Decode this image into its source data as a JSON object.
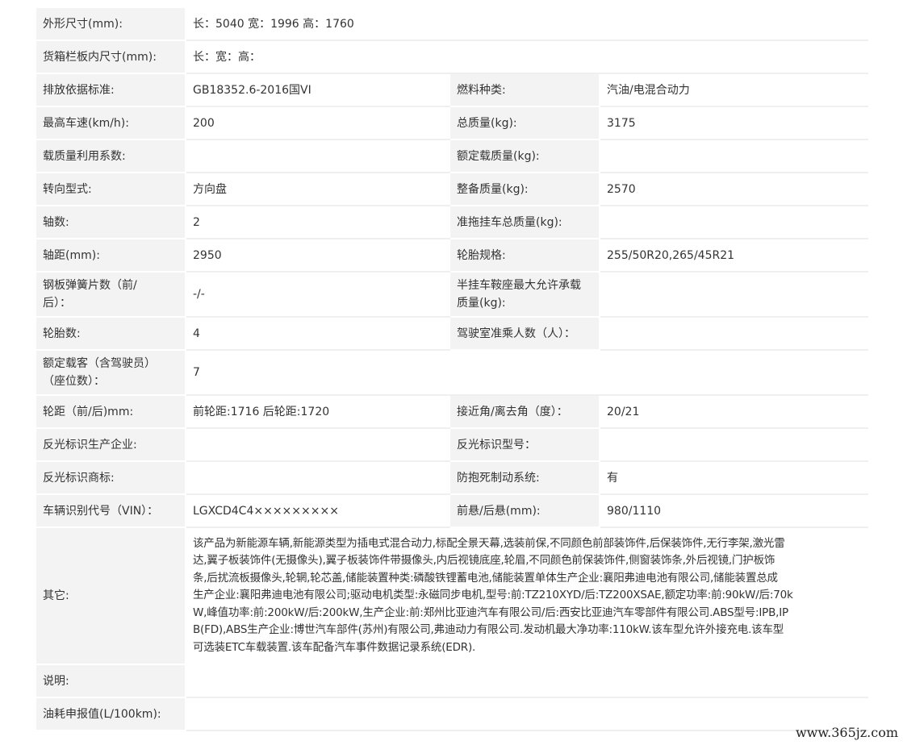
{
  "rows": [
    {
      "label": "外形尺寸(mm):",
      "value": "长：5040 宽：1996 高：1760"
    },
    {
      "label": "货箱栏板内尺寸(mm):",
      "value": "长：宽：高："
    },
    {
      "label": "排放依据标准:",
      "value": "GB18352.6-2016国VI",
      "label2": "燃料种类:",
      "value2": "汽油/电混合动力"
    },
    {
      "label": "最高车速(km/h):",
      "value": "200",
      "label2": "总质量(kg):",
      "value2": "3175"
    },
    {
      "label": "载质量利用系数:",
      "value": "",
      "label2": "额定载质量(kg):",
      "value2": ""
    },
    {
      "label": "转向型式:",
      "value": "方向盘",
      "label2": "整备质量(kg):",
      "value2": "2570"
    },
    {
      "label": "轴数:",
      "value": "2",
      "label2": "准拖挂车总质量(kg):",
      "value2": ""
    },
    {
      "label": "轴距(mm):",
      "value": "2950",
      "label2": "轮胎规格:",
      "value2": "255/50R20,265/45R21"
    },
    {
      "label_lines": [
        "钢板弹簧片数（前/",
        "后）："
      ],
      "value": "-/-",
      "label2_lines": [
        "半挂车鞍座最大允许承载",
        "质量(kg):"
      ],
      "value2": ""
    },
    {
      "label": "轮胎数:",
      "value": "4",
      "label2": "驾驶室准乘人数（人）：",
      "value2": ""
    },
    {
      "label_lines": [
        "额定载客（含驾驶员）",
        "（座位数）："
      ],
      "value": "7"
    },
    {
      "label": "轮距（前/后)mm:",
      "value": "前轮距:1716 后轮距:1720",
      "label2": "接近角/离去角（度）：",
      "value2": "20/21"
    },
    {
      "label": "反光标识生产企业:",
      "value": "",
      "label2": "反光标识型号：",
      "value2": ""
    },
    {
      "label": "反光标识商标:",
      "value": "",
      "label2": "防抱死制动系统:",
      "value2": "有"
    },
    {
      "label": "车辆识别代号（VIN）：",
      "value": "LGXCD4C4×××××××××",
      "label2": "前悬/后悬(mm):",
      "value2": "980/1110"
    }
  ],
  "other": {
    "label": "其它:",
    "lines": [
      "该产品为新能源车辆,新能源类型为插电式混合动力,标配全景天幕,选装前保,不同颜色前部装饰件,后保装饰件,无行李架,激光雷",
      "达,翼子板装饰件(无摄像头),翼子板装饰件带摄像头,内后视镜底座,轮眉,不同颜色前保装饰件,侧窗装饰条,外后视镜,门护板饰",
      "条,后扰流板摄像头,轮辋,轮芯盖,储能装置种类:磷酸铁锂蓄电池,储能装置单体生产企业:襄阳弗迪电池有限公司,储能装置总成",
      "生产企业:襄阳弗迪电池有限公司;驱动电机类型:永磁同步电机,型号:前:TZ210XYD/后:TZ200XSAE,额定功率:前:90kW/后:70k",
      "W,峰值功率:前:200kW/后:200kW,生产企业:前:郑州比亚迪汽车有限公司/后:西安比亚迪汽车零部件有限公司.ABS型号:IPB,IP",
      "B(FD),ABS生产企业:博世汽车部件(苏州)有限公司,弗迪动力有限公司.发动机最大净功率:110kW.该车型允许外接充电.该车型",
      "可选装ETC车载装置.该车配备汽车事件数据记录系统(EDR)."
    ]
  },
  "note": {
    "label": "说明:",
    "value": ""
  },
  "fuel": {
    "label": "油耗申报值(L/100km):",
    "value": ""
  },
  "watermark": "www.365jz.com"
}
